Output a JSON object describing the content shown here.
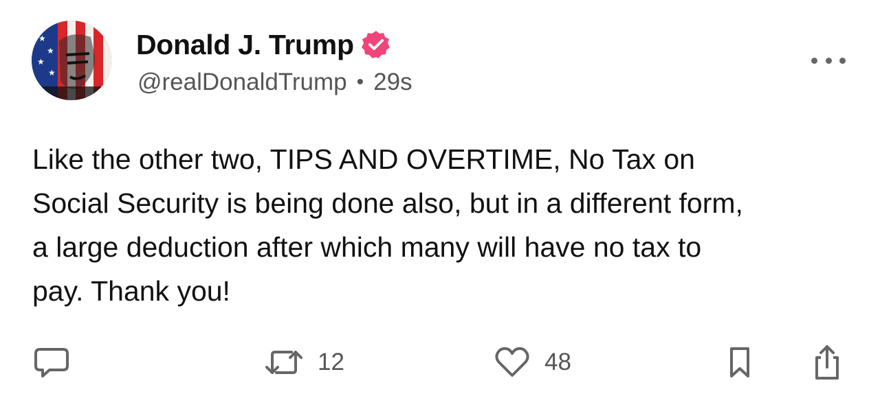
{
  "post": {
    "author": {
      "display_name": "Donald J. Trump",
      "handle": "@realDonaldTrump",
      "verified": true
    },
    "timestamp": "29s",
    "separator": "•",
    "content": "Like the other two, TIPS AND OVERTIME, No Tax on\nSocial Security is being done also, but in a different form,\na large deduction after which many will have no tax to\npay. Thank you!",
    "stats": {
      "reposts": "12",
      "likes": "48"
    }
  },
  "icons": {
    "avatar": "avatar-image",
    "verified": "verified-badge-icon",
    "more": "more-options-icon",
    "reply": "reply-icon",
    "repost": "repost-icon",
    "like": "heart-icon",
    "bookmark": "bookmark-icon",
    "share": "share-icon"
  },
  "colors": {
    "verified_badge": "#f0457a",
    "icon_gray": "#666666",
    "text": "#111111"
  }
}
